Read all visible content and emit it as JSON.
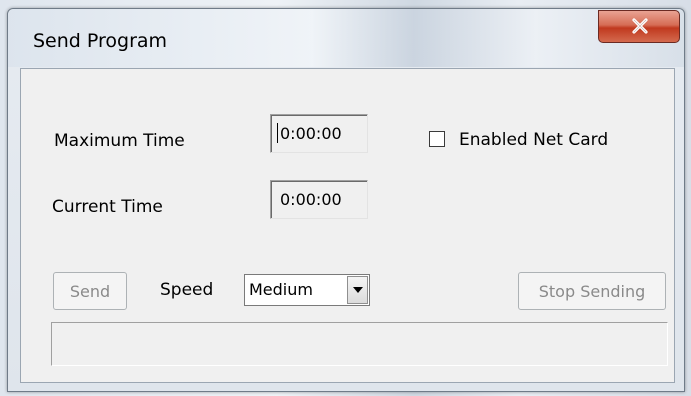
{
  "window": {
    "title": "Send Program"
  },
  "form": {
    "max_time_label": "Maximum Time",
    "max_time_value": "0:00:00",
    "current_time_label": "Current Time",
    "current_time_value": "0:00:00",
    "netcard_label": "Enabled Net Card",
    "netcard_checked": false,
    "send_label": "Send",
    "speed_label": "Speed",
    "speed_value": "Medium",
    "stop_label": "Stop Sending",
    "status_text": ""
  },
  "colors": {
    "close_button": "#c0391f",
    "disabled_text": "#8a8a8a",
    "client_bg": "#f0f0f0"
  },
  "icons": {
    "close": "close-icon",
    "dropdown": "chevron-down-icon"
  }
}
